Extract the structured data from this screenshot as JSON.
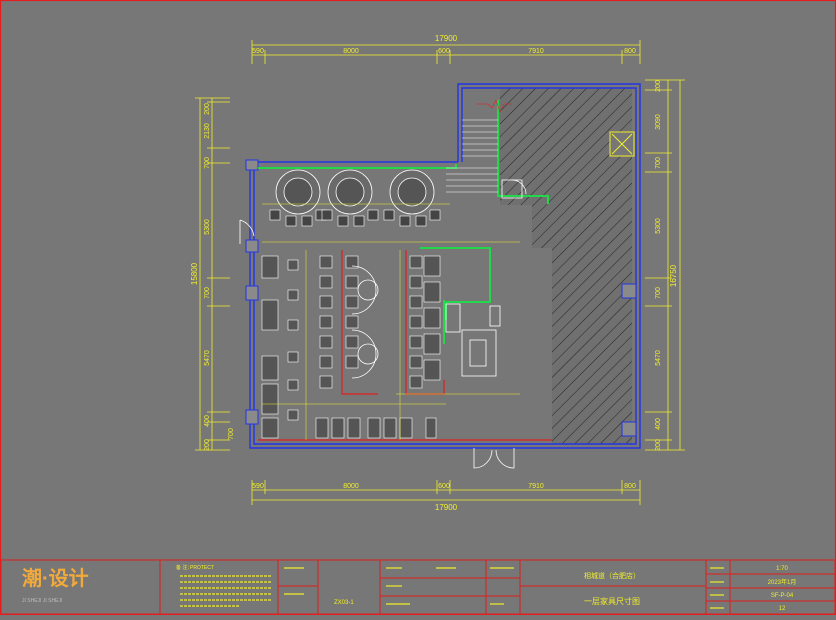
{
  "top_dims": {
    "total": "17900",
    "segments": [
      "590",
      "8000",
      "600",
      "7910",
      "800"
    ]
  },
  "bottom_dims": {
    "total": "17900",
    "segments": [
      "590",
      "8000",
      "600",
      "7910",
      "800"
    ]
  },
  "left_dims": {
    "total": "15800",
    "segments": [
      "200",
      "2130",
      "700",
      "5300",
      "700",
      "5470",
      "400",
      "700",
      "200"
    ]
  },
  "right_dims": {
    "total": "16750",
    "segments": [
      "200",
      "3090",
      "700",
      "5300",
      "700",
      "5470",
      "400",
      "200"
    ]
  },
  "title_block": {
    "logo_text": "潮·设计",
    "logo_sub": "JI SHEJI    JI SHEJI",
    "notes_label": "备 注：",
    "notes_value": "PROTECT",
    "drawing_title": "一层家具尺寸图",
    "project_name": "相城道（合肥店）",
    "scale": "1:70",
    "date": "2023年1月",
    "drawing_no": "SF-P-04",
    "sheet": "12",
    "code": "ZX03-1"
  },
  "colors": {
    "background": "#777777",
    "dimension": "#f2ef2a",
    "outer_wall": "#2135e8",
    "partition": "#22d84a",
    "accent": "#e21e1e",
    "furniture": "#ffffff",
    "hatch": "#1b1b1b"
  }
}
